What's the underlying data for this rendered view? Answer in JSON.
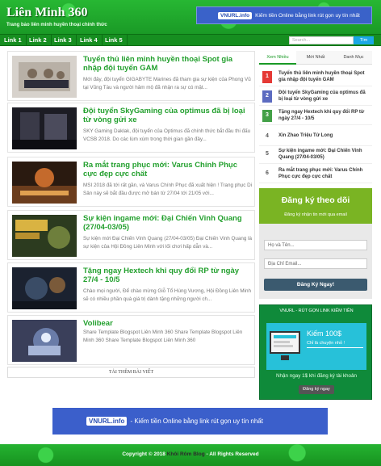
{
  "header": {
    "title": "Liên Minh 360",
    "description": "Trang bảo liên minh huyền thoại chính thức",
    "banner": {
      "logo": "VNURL.info",
      "text": "Kiếm tiền Online bằng link rút gọn uy tín nhất"
    }
  },
  "nav": {
    "links": [
      "Link 1",
      "Link 2",
      "Link 3",
      "Link 4",
      "Link 5"
    ],
    "search_placeholder": "Search...",
    "search_button": "Tìm"
  },
  "posts": [
    {
      "title": "Tuyển thủ liên minh huyền thoại Spot gia nhập đội tuyển GAM",
      "snippet": "Mới đây, đội tuyển GIGABYTE Marines đã tham gia sự kiện của Phong Vũ tại Vũng Tàu và người hâm mộ đã nhận ra sự có mặt..."
    },
    {
      "title": "Đội tuyển SkyGaming của optimus đã bị loại từ vòng gửi xe",
      "snippet": "SKY Gaming Daklak, đội tuyển của Optimus đã chính thức bắt đầu thi đấu VCSB 2018. Do các lùm xùm trong thời gian gần đây..."
    },
    {
      "title": "Ra mắt trang phục mới: Varus Chính Phục cực đẹp cực chất",
      "snippet": "MSI 2018 đã tới rất gần, và Varus Chính Phục đã xuất hiện ! Trang phục Di Sản này sẽ bắt đầu được mở bán từ 27/04 tới 21/05 với..."
    },
    {
      "title": "Sự kiện ingame mới: Đại Chiến Vinh Quang (27/04-03/05)",
      "snippet": "Sự kiện mới Đại Chiến Vinh Quang (27/04-03/05) Đại Chiến Vinh Quang là sự kiện của Hội Đồng Liên Minh với lối chơi hấp dẫn và..."
    },
    {
      "title": "Tặng ngay Hextech khi quy đổi RP từ ngày 27/4 - 10/5",
      "snippet": "Chào mọi người, Để chào mừng Giỗ Tổ Hùng Vương, Hội Đồng Liên Minh sẽ có nhiều phần quà giá trị dành tặng những người ch..."
    },
    {
      "title": "Volibear",
      "snippet": "Share Template Blogspot Liên Minh 360 Share Template Blogspot Liên Minh 360 Share Template Blogspot Liên Minh 360"
    }
  ],
  "read_more": "TẢI THÊM BÀI VIẾT",
  "sidebar": {
    "tabs": [
      "Xem Nhiều",
      "Mới Nhất",
      "Danh Mục"
    ],
    "popular": [
      {
        "rank": "1",
        "title": "Tuyển thủ liên minh huyền thoại Spot gia nhập đội tuyển GAM",
        "color": "#e53935"
      },
      {
        "rank": "2",
        "title": "Đội tuyển SkyGaming của optimus đã bị loại từ vòng gửi xe",
        "color": "#5c6bc0"
      },
      {
        "rank": "3",
        "title": "Tặng ngay Hextech khi quy đổi RP từ ngày 27/4 - 10/5",
        "color": "#43a047"
      },
      {
        "rank": "4",
        "title": "Xin Zhao Triệu Tử Long",
        "color": ""
      },
      {
        "rank": "5",
        "title": "Sự kiện ingame mới: Đại Chiến Vinh Quang (27/04-03/05)",
        "color": ""
      },
      {
        "rank": "6",
        "title": "Ra mắt trang phục mới: Varus Chính Phục cực đẹp cực chất",
        "color": ""
      }
    ],
    "subscribe": {
      "title": "Đăng ký theo dõi",
      "description": "Đăng ký nhận tin mới qua email",
      "name_placeholder": "Họ và Tên...",
      "email_placeholder": "Địa Chỉ Email...",
      "button": "Đăng Ký Ngay!"
    },
    "vnurl": {
      "heading": "VNURL - RÚT GỌN LINK KIẾM TIỀN",
      "amount": "Kiếm 100$",
      "sub": "Chỉ là chuyện nhỏ !",
      "cta": "Nhận ngay 1$ khi đăng ký tài khoản",
      "button": "Đăng ký ngay"
    }
  },
  "bottom_banner": {
    "logo": "VNURL.info",
    "text": "- Kiếm tiền Online bằng link rút gọn uy tín nhất"
  },
  "footer": {
    "prefix": "Copyright © 2018",
    "brand": "Khôi Rôm Blog",
    "suffix": " - All Rights Reserved"
  }
}
